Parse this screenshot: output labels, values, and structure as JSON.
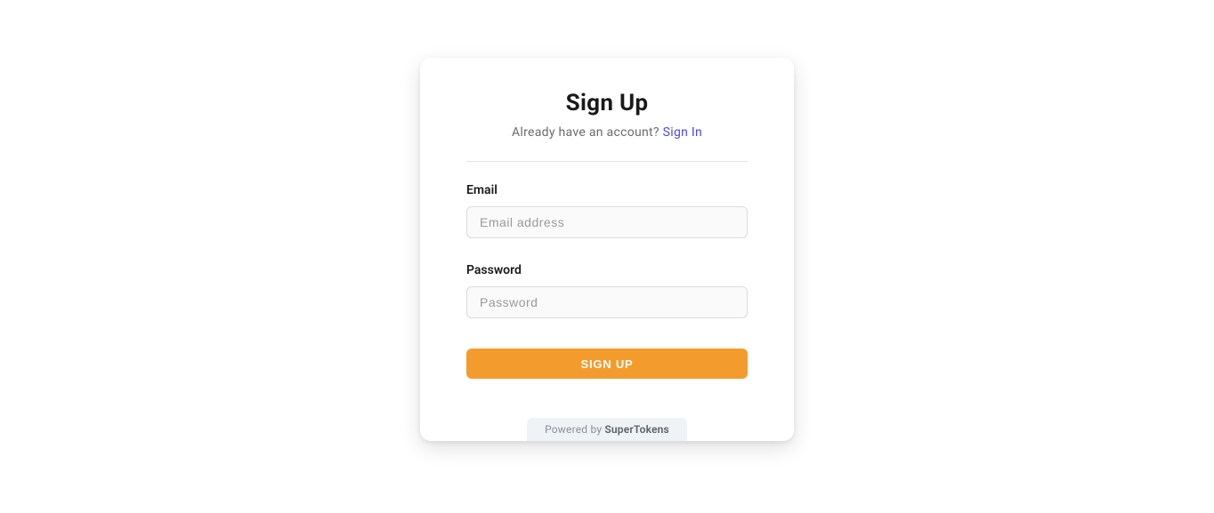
{
  "title": "Sign Up",
  "subtitle": {
    "prompt": "Already have an account? ",
    "link": "Sign In"
  },
  "fields": {
    "email": {
      "label": "Email",
      "placeholder": "Email address",
      "value": ""
    },
    "password": {
      "label": "Password",
      "placeholder": "Password",
      "value": ""
    }
  },
  "submit": {
    "label": "SIGN UP"
  },
  "footer": {
    "prefix": "Powered by ",
    "brand": "SuperTokens"
  }
}
